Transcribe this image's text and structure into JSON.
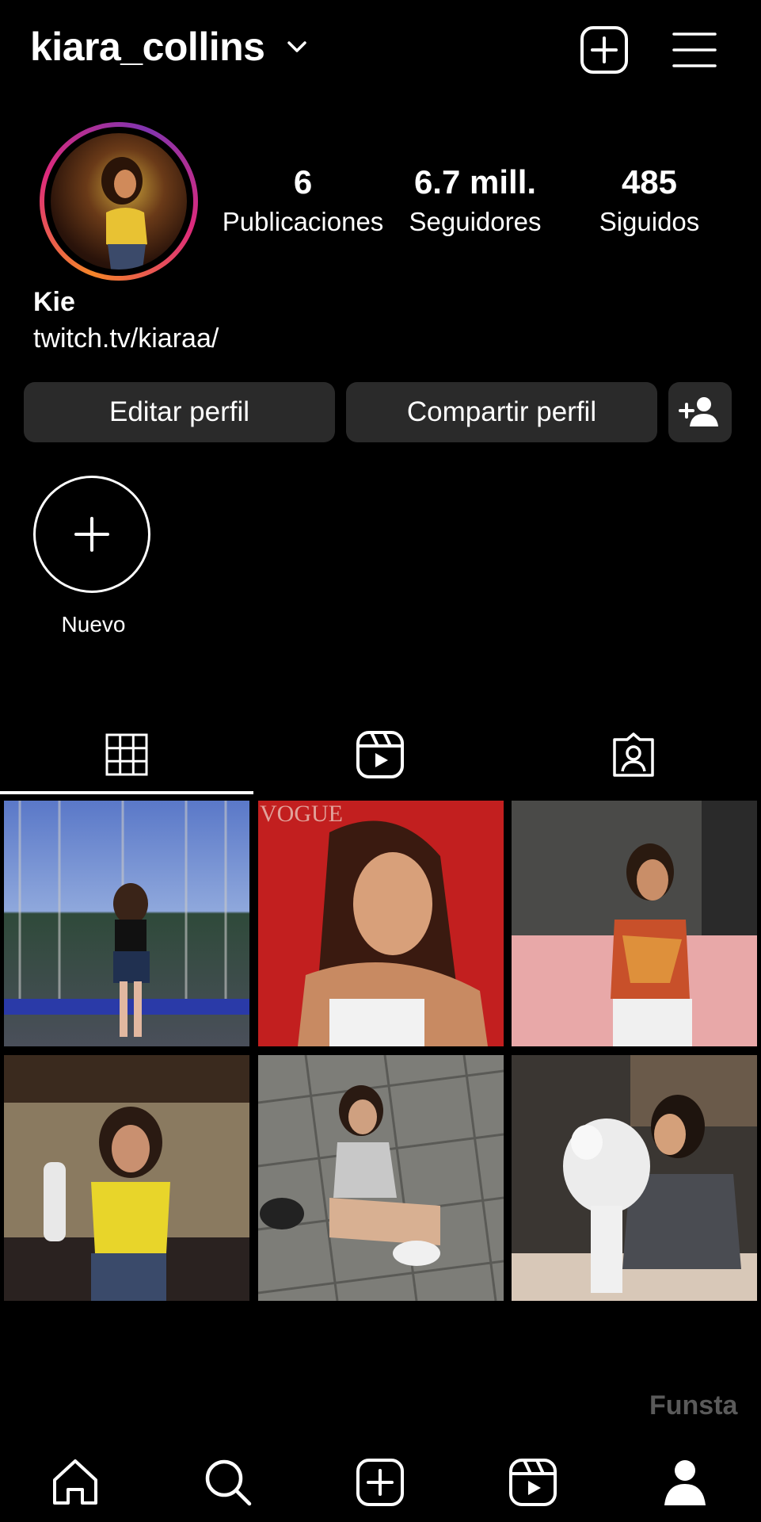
{
  "header": {
    "username": "kiara_collins"
  },
  "stats": [
    {
      "value": "6",
      "label": "Publicaciones"
    },
    {
      "value": "6.7 mill.",
      "label": "Seguidores"
    },
    {
      "value": "485",
      "label": "Siguidos"
    }
  ],
  "profile": {
    "name": "Kie",
    "link": "twitch.tv/kiaraa/"
  },
  "buttons": {
    "edit": "Editar perfil",
    "share": "Compartir perfil"
  },
  "highlight": {
    "new_label": "Nuevo"
  },
  "tabs": [
    "grid-icon",
    "reels-icon",
    "tagged-icon"
  ],
  "posts": [
    {
      "caption": "",
      "overlay": ""
    },
    {
      "caption": "",
      "overlay": "VOGUE"
    },
    {
      "caption": "",
      "overlay": ""
    },
    {
      "caption": "",
      "overlay": ""
    },
    {
      "caption": "",
      "overlay": ""
    },
    {
      "caption": "",
      "overlay": ""
    }
  ],
  "watermark": "Funsta",
  "bottom_nav": [
    "home-icon",
    "search-icon",
    "create-icon",
    "reels-icon",
    "profile-icon"
  ],
  "colors": {
    "background": "#000000",
    "button": "#2a2a2a",
    "ring_start": "#f58529",
    "ring_end": "#dd2a7b"
  }
}
